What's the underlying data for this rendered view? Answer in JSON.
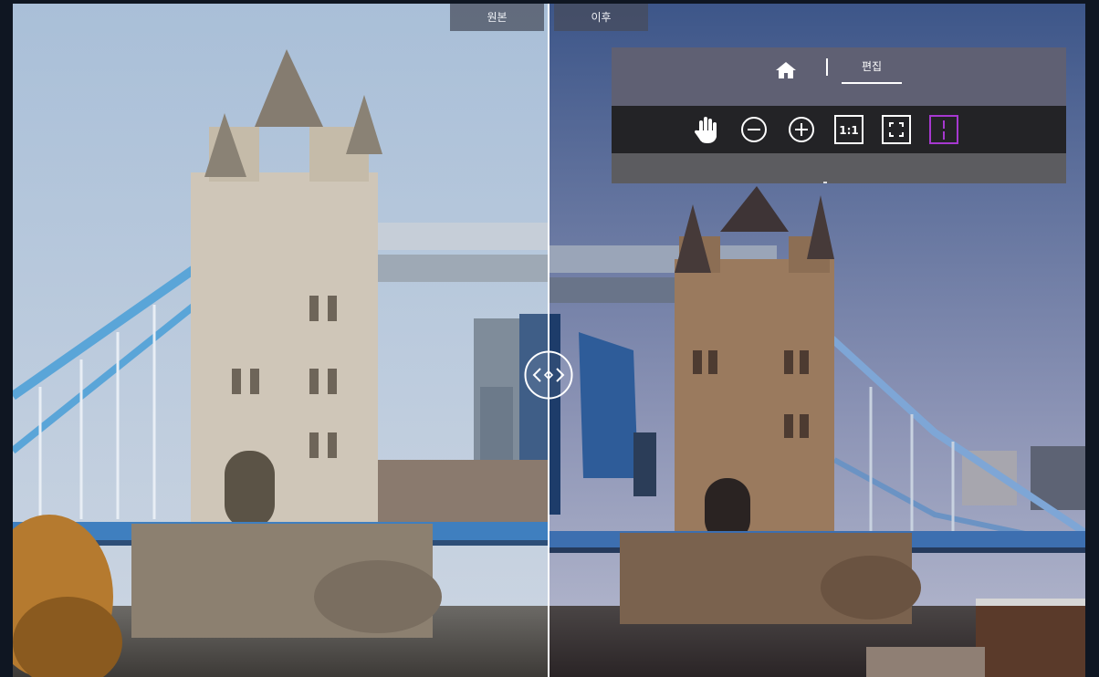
{
  "compare": {
    "original_label": "원본",
    "after_label": "이후",
    "split_position": 0.5
  },
  "panel": {
    "nav": {
      "home_icon": "home-icon",
      "edit_tab_label": "편집"
    },
    "toolbar": {
      "tools": [
        {
          "name": "hand-tool",
          "icon": "hand-icon"
        },
        {
          "name": "zoom-out",
          "icon": "minus-circle-icon"
        },
        {
          "name": "zoom-in",
          "icon": "plus-circle-icon"
        },
        {
          "name": "actual-size",
          "icon": "one-to-one-icon",
          "text": "1:1"
        },
        {
          "name": "fit-to-screen",
          "icon": "fit-frame-icon"
        },
        {
          "name": "split-view",
          "icon": "split-view-icon",
          "active": true
        }
      ]
    }
  },
  "colors": {
    "panel_bg": "#5f6073",
    "toolbar_bg": "#232326",
    "active_tool": "#a638d0",
    "label_bg": "#464b5a"
  }
}
